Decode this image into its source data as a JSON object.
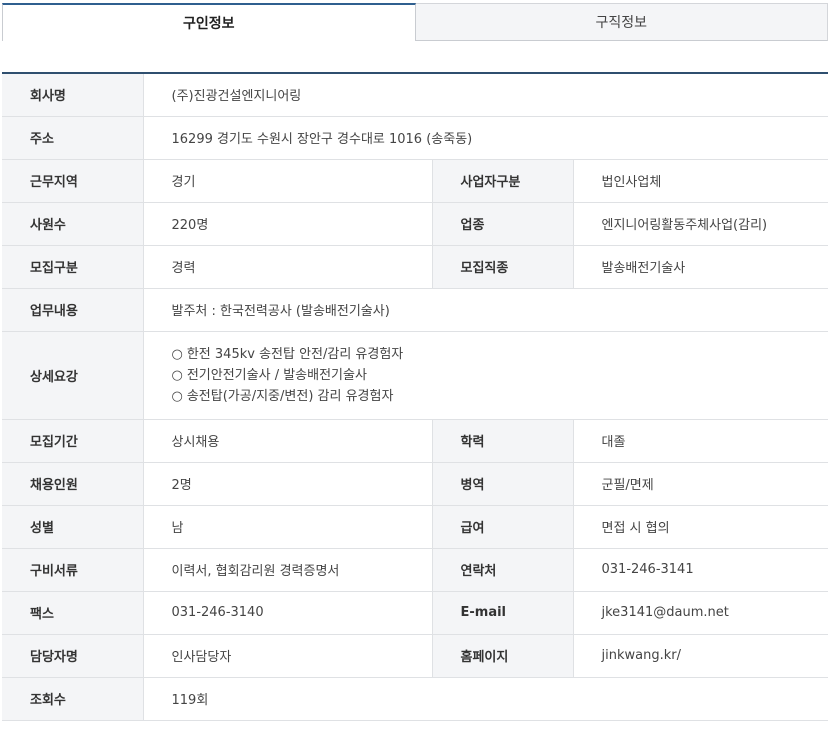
{
  "tabs": [
    {
      "label": "구인정보",
      "active": true
    },
    {
      "label": "구직정보",
      "active": false
    }
  ],
  "fields": {
    "company_label": "회사명",
    "company": "(주)진광건설엔지니어링",
    "address_label": "주소",
    "address": "16299 경기도 수원시 장안구 경수대로 1016 (송죽동)",
    "region_label": "근무지역",
    "region": "경기",
    "biztype_label": "사업자구분",
    "biztype": "법인사업체",
    "employees_label": "사원수",
    "employees": "220명",
    "industry_label": "업종",
    "industry": "엔지니어링활동주체사업(감리)",
    "recruit_type_label": "모집구분",
    "recruit_type": "경력",
    "recruit_job_label": "모집직종",
    "recruit_job": "발송배전기술사",
    "duty_label": "업무내용",
    "duty": "발주처 : 한국전력공사 (발송배전기술사)",
    "requirements_label": "상세요강",
    "requirements": [
      "한전 345kv 송전탑 안전/감리 유경험자",
      "전기안전기술사 / 발송배전기술사",
      "송전탑(가공/지중/변전) 감리 유경험자"
    ],
    "bullet": "○",
    "period_label": "모집기간",
    "period": "상시채용",
    "education_label": "학력",
    "education": "대졸",
    "headcount_label": "채용인원",
    "headcount": "2명",
    "military_label": "병역",
    "military": "군필/면제",
    "gender_label": "성별",
    "gender": "남",
    "salary_label": "급여",
    "salary": "면접 시 협의",
    "documents_label": "구비서류",
    "documents": "이력서, 협회감리원 경력증명서",
    "contact_label": "연락처",
    "contact": "031-246-3141",
    "fax_label": "팩스",
    "fax": "031-246-3140",
    "email_label": "E-mail",
    "email": "jke3141@daum.net",
    "manager_label": "담당자명",
    "manager": "인사담당자",
    "homepage_label": "홈페이지",
    "homepage": "jinkwang.kr/",
    "views_label": "조회수",
    "views": "119회"
  }
}
